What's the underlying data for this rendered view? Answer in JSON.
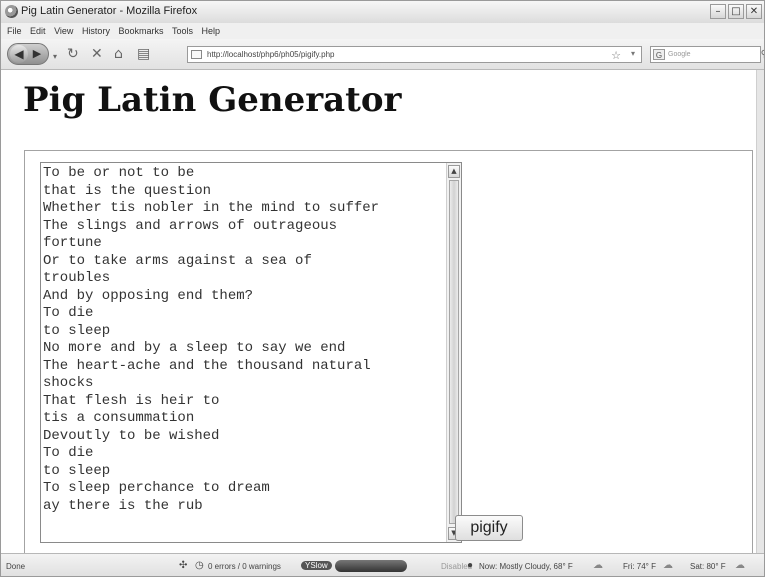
{
  "window": {
    "title": "Pig Latin Generator - Mozilla Firefox"
  },
  "menubar": {
    "items": [
      "File",
      "Edit",
      "View",
      "History",
      "Bookmarks",
      "Tools",
      "Help"
    ]
  },
  "navbar": {
    "url": "http://localhost/php6/ph05/pigify.php",
    "search_placeholder": "Google",
    "search_engine": "G"
  },
  "page": {
    "heading": "Pig Latin Generator",
    "textarea_text": "To be or not to be\nthat is the question\nWhether tis nobler in the mind to suffer\nThe slings and arrows of outrageous\nfortune\nOr to take arms against a sea of\ntroubles\nAnd by opposing end them?\nTo die\nto sleep\nNo more and by a sleep to say we end\nThe heart-ache and the thousand natural\nshocks\nThat flesh is heir to\ntis a consummation\nDevoutly to be wished\nTo die\nto sleep\nTo sleep perchance to dream\nay there is the rub",
    "button_label": "pigify"
  },
  "status": {
    "done": "Done",
    "errors": "0 errors / 0 warnings",
    "yslow": "YSlow",
    "disabled": "Disabled",
    "weather_now": "Now: Mostly Cloudy, 68° F",
    "weather_fri": "Fri: 74° F",
    "weather_sat": "Sat: 80° F"
  }
}
